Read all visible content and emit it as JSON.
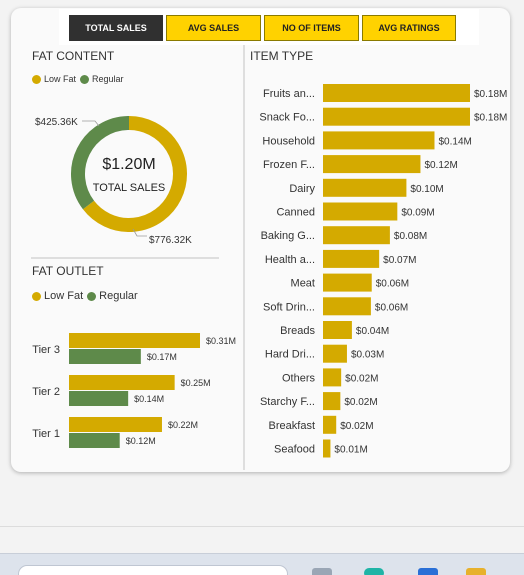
{
  "tabs": [
    {
      "label": "TOTAL SALES",
      "active": true
    },
    {
      "label": "AVG SALES",
      "active": false
    },
    {
      "label": "NO OF ITEMS",
      "active": false
    },
    {
      "label": "AVG RATINGS",
      "active": false
    }
  ],
  "colors": {
    "gold": "#d4aa00",
    "green": "#5e8a4a",
    "tab_yellow": "#ffd200",
    "tab_dark": "#303030"
  },
  "fat_content": {
    "title": "FAT CONTENT",
    "legend": [
      "Low Fat",
      "Regular"
    ],
    "center_value": "$1.20M",
    "center_label": "TOTAL SALES",
    "labels": {
      "regular": "$425.36K",
      "low_fat": "$776.32K"
    }
  },
  "fat_outlet": {
    "title": "FAT OUTLET",
    "legend": [
      "Low Fat",
      "Regular"
    ]
  },
  "item_type": {
    "title": "ITEM TYPE"
  },
  "chart_data": [
    {
      "type": "pie",
      "title": "FAT CONTENT",
      "categories": [
        "Low Fat",
        "Regular"
      ],
      "values": [
        776.32,
        425.36
      ],
      "value_labels": [
        "$776.32K",
        "$425.36K"
      ],
      "unit": "K",
      "center_text": [
        "$1.20M",
        "TOTAL SALES"
      ],
      "donut": true,
      "legend": "top-left"
    },
    {
      "type": "bar",
      "orientation": "horizontal",
      "title": "FAT OUTLET",
      "categories": [
        "Tier 3",
        "Tier 2",
        "Tier 1"
      ],
      "series": [
        {
          "name": "Low Fat",
          "values": [
            0.31,
            0.25,
            0.22
          ],
          "labels": [
            "$0.31M",
            "$0.25M",
            "$0.22M"
          ]
        },
        {
          "name": "Regular",
          "values": [
            0.17,
            0.14,
            0.12
          ],
          "labels": [
            "$0.17M",
            "$0.14M",
            "$0.12M"
          ]
        }
      ],
      "xlim": [
        0,
        0.31
      ],
      "legend": "top-left",
      "grid": false
    },
    {
      "type": "bar",
      "orientation": "horizontal",
      "title": "ITEM TYPE",
      "categories": [
        "Fruits an...",
        "Snack Fo...",
        "Household",
        "Frozen F...",
        "Dairy",
        "Canned",
        "Baking G...",
        "Health a...",
        "Meat",
        "Soft Drin...",
        "Breads",
        "Hard Dri...",
        "Others",
        "Starchy F...",
        "Breakfast",
        "Seafood"
      ],
      "values": [
        0.178,
        0.178,
        0.135,
        0.118,
        0.101,
        0.09,
        0.081,
        0.068,
        0.059,
        0.058,
        0.035,
        0.029,
        0.022,
        0.021,
        0.016,
        0.009
      ],
      "value_labels": [
        "$0.18M",
        "$0.18M",
        "$0.14M",
        "$0.12M",
        "$0.10M",
        "$0.09M",
        "$0.08M",
        "$0.07M",
        "$0.06M",
        "$0.06M",
        "$0.04M",
        "$0.03M",
        "$0.02M",
        "$0.02M",
        "$0.02M",
        "$0.01M"
      ],
      "xlim": [
        0,
        0.178
      ],
      "grid": false
    }
  ]
}
